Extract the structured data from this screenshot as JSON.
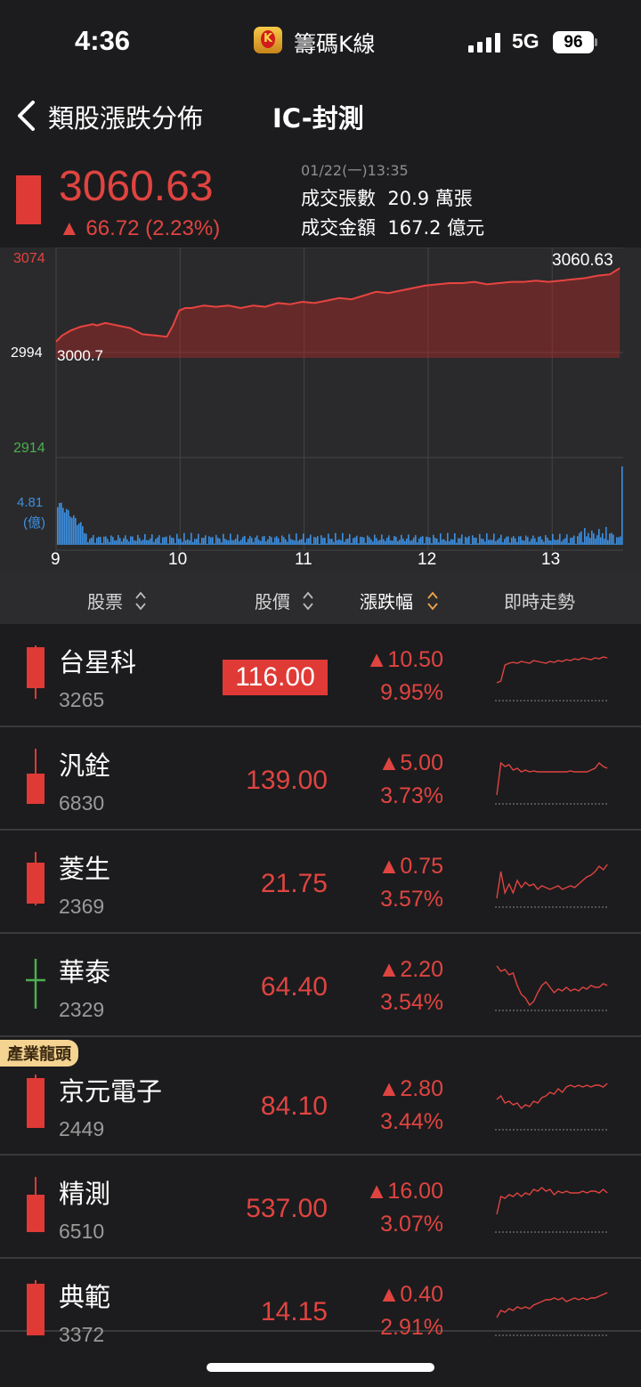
{
  "status": {
    "time": "4:36",
    "app_name": "籌碼K線",
    "app_logo_letter": "K",
    "network": "5G",
    "battery": "96"
  },
  "nav": {
    "back_label": "類股漲跌分佈",
    "title": "IC-封測"
  },
  "quote": {
    "price": "3060.63",
    "change": "▲ 66.72 (2.23%)",
    "date": "01/22(一)13:35",
    "volume_label": "成交張數",
    "volume": "20.9 萬張",
    "amount_label": "成交金額",
    "amount": "167.2 億元"
  },
  "chart_data": {
    "type": "area",
    "y_ticks": [
      "3074",
      "2994",
      "2914"
    ],
    "y_colors": {
      "3074": "#e04440",
      "2994": "#ffffff",
      "2914": "#4caf50"
    },
    "last_price_label": "3060.63",
    "ref_price_label": "3000.7",
    "ylim": [
      2914,
      3074
    ],
    "ref_price": 2994,
    "x_ticks": [
      "9",
      "10",
      "11",
      "12",
      "13"
    ],
    "price_x": [
      0,
      0.05,
      0.12,
      0.2,
      0.3,
      0.33,
      0.4,
      0.45,
      0.5,
      0.6,
      0.7,
      0.8,
      0.9,
      0.95,
      1.0,
      1.05,
      1.1,
      1.2,
      1.3,
      1.4,
      1.5,
      1.6,
      1.7,
      1.8,
      1.9,
      2.0,
      2.1,
      2.2,
      2.3,
      2.4,
      2.5,
      2.6,
      2.7,
      2.8,
      2.9,
      3.0,
      3.1,
      3.2,
      3.3,
      3.4,
      3.5,
      3.6,
      3.7,
      3.8,
      3.9,
      4.0,
      4.1,
      4.2,
      4.3,
      4.4,
      4.5,
      4.58
    ],
    "price_y": [
      3007,
      3012,
      3016,
      3019,
      3021,
      3020,
      3022,
      3021,
      3020,
      3018,
      3013,
      3012,
      3011,
      3020,
      3032,
      3034,
      3034,
      3036,
      3035,
      3036,
      3034,
      3036,
      3035,
      3038,
      3037,
      3039,
      3038,
      3040,
      3042,
      3041,
      3044,
      3047,
      3046,
      3048,
      3050,
      3052,
      3053,
      3054,
      3054,
      3055,
      3053,
      3054,
      3055,
      3055,
      3056,
      3055,
      3056,
      3057,
      3058,
      3060,
      3061,
      3066
    ],
    "volume_unit": "4.81\n(億)",
    "volume_max_label": "4.81",
    "volume_unit_label": "(億)",
    "volume_max": 4.81
  },
  "table": {
    "headers": {
      "stock": "股票",
      "price": "股價",
      "change": "漲跌幅",
      "trend": "即時走勢"
    },
    "badge": "產業龍頭",
    "rows": [
      {
        "name": "台星科",
        "code": "3265",
        "price": "116.00",
        "change": "▲10.50",
        "pct": "9.95%",
        "candle": "up",
        "highlight": true
      },
      {
        "name": "汎銓",
        "code": "6830",
        "price": "139.00",
        "change": "▲5.00",
        "pct": "3.73%",
        "candle": "up",
        "highlight": false
      },
      {
        "name": "菱生",
        "code": "2369",
        "price": "21.75",
        "change": "▲0.75",
        "pct": "3.57%",
        "candle": "up",
        "highlight": false
      },
      {
        "name": "華泰",
        "code": "2329",
        "price": "64.40",
        "change": "▲2.20",
        "pct": "3.54%",
        "candle": "cross",
        "highlight": false
      },
      {
        "name": "京元電子",
        "code": "2449",
        "price": "84.10",
        "change": "▲2.80",
        "pct": "3.44%",
        "candle": "up",
        "highlight": false
      },
      {
        "name": "精測",
        "code": "6510",
        "price": "537.00",
        "change": "▲16.00",
        "pct": "3.07%",
        "candle": "up",
        "highlight": false
      },
      {
        "name": "典範",
        "code": "3372",
        "price": "14.15",
        "change": "▲0.40",
        "pct": "2.91%",
        "candle": "up",
        "highlight": false
      }
    ]
  },
  "colors": {
    "up": "#e03a36",
    "down": "#4caf50",
    "volume": "#3d8fe0",
    "bg": "#1c1c1e"
  }
}
